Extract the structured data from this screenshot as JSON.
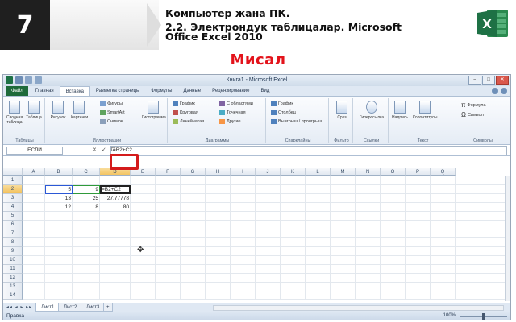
{
  "slide": {
    "grade": "7",
    "title_line1": "Компьютер жана ПК.",
    "title_line2": "2.2. Электрондук таблицалар. Microsoft",
    "title_line3": "Office Excel 2010",
    "section_label": "Мисал",
    "colors": {
      "accent_red": "#e3131b",
      "excel_green": "#1e7145"
    }
  },
  "excel": {
    "window_title": "Книга1 - Microsoft Excel",
    "file_tab": "Файл",
    "tabs": [
      "Главная",
      "Вставка",
      "Разметка страницы",
      "Формулы",
      "Данные",
      "Рецензирование",
      "Вид"
    ],
    "active_tab_index": 1,
    "ribbon": {
      "groups": [
        "Таблицы",
        "Иллюстрации",
        "Диаграммы",
        "Спарклайны",
        "Фильтр",
        "Ссылки",
        "Текст",
        "Символы"
      ],
      "buttons": {
        "pivot": "Сводная таблица",
        "table": "Таблица",
        "picture": "Рисунок",
        "clipart": "Картинки",
        "shapes": "Фигуры",
        "smartart": "SmartArt",
        "screenshot": "Снимок",
        "histogram": "Гистограмма",
        "graph": "График",
        "pie": "Круговая",
        "bar": "Линейчатая",
        "area": "С областями",
        "scatter": "Точечная",
        "other": "Другие",
        "sp_graph": "График",
        "sp_column": "Столбец",
        "sp_winloss": "Выигрыш / проигрыш",
        "slicer": "Срез",
        "hyperlink": "Гиперссылка",
        "textbox": "Надпись",
        "header_footer": "Колонтитулы",
        "formula": "Формула",
        "symbol": "Символ"
      }
    },
    "formula_bar": {
      "name_box": "ЕСЛИ",
      "cancel_icon": "✕",
      "enter_icon": "✓",
      "fx_label": "fx",
      "formula": "=B2+C2"
    },
    "columns": [
      "A",
      "B",
      "C",
      "D",
      "E",
      "F",
      "G",
      "H",
      "I",
      "J",
      "K",
      "L",
      "M",
      "N",
      "O",
      "P",
      "Q"
    ],
    "rows": [
      "1",
      "2",
      "3",
      "4",
      "5",
      "6",
      "7",
      "8",
      "9",
      "10",
      "11",
      "12",
      "13",
      "14"
    ],
    "cells": {
      "B2": "5",
      "C2": "9",
      "D2": "=B2+C2",
      "B3": "13",
      "C3": "25",
      "D3": "27,77778",
      "B4": "12",
      "C4": "8",
      "D4": "80"
    },
    "sheets": [
      "Лист1",
      "Лист2",
      "Лист3"
    ],
    "active_sheet_index": 0,
    "status": "Правка",
    "zoom": "100%"
  }
}
